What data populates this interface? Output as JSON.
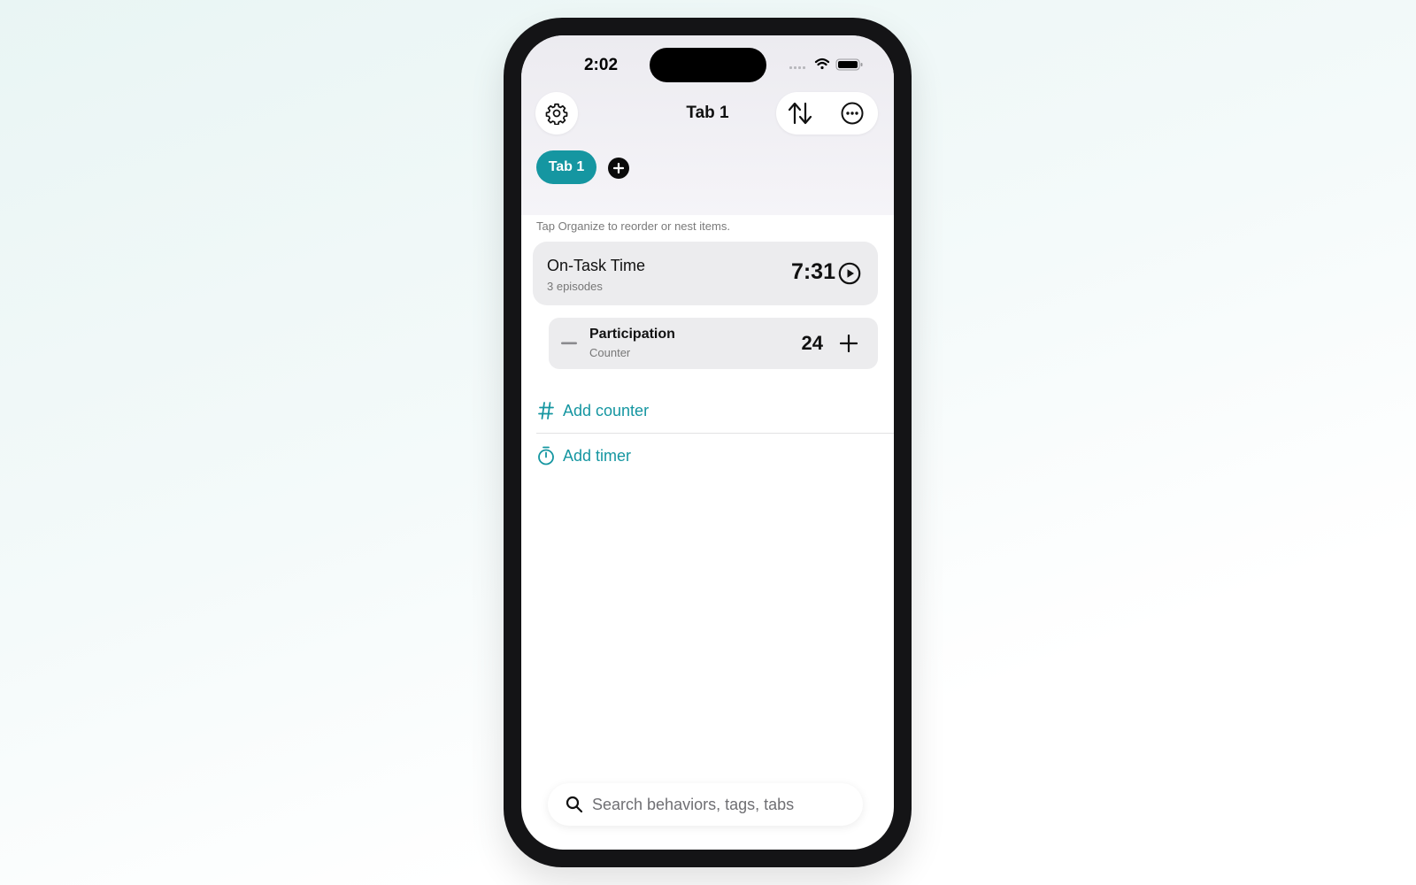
{
  "status_bar": {
    "time": "2:02"
  },
  "nav": {
    "title": "Tab 1"
  },
  "tabs": [
    {
      "label": "Tab 1",
      "selected": true
    }
  ],
  "hint": "Tap Organize to reorder or nest items.",
  "timer_item": {
    "title": "On-Task Time",
    "subtitle": "3 episodes",
    "value": "7:31"
  },
  "counter_item": {
    "title": "Participation",
    "subtitle": "Counter",
    "value": "24"
  },
  "actions": {
    "add_counter": "Add counter",
    "add_timer": "Add timer"
  },
  "search": {
    "placeholder": "Search behaviors, tags, tabs"
  },
  "icons": {
    "settings": "gear-icon",
    "sort": "arrows-up-down-icon",
    "more": "ellipsis-circle-icon",
    "add_tab": "plus-circle-icon",
    "play": "play-circle-icon",
    "decrement": "minus-icon",
    "increment": "plus-icon",
    "add_counter": "hash-icon",
    "add_timer": "stopwatch-icon",
    "search": "magnifier-icon"
  },
  "colors": {
    "accent": "#1596a1",
    "card": "#ececee"
  }
}
